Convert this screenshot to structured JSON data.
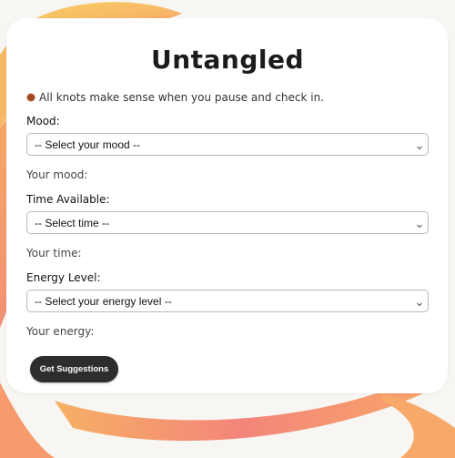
{
  "app": {
    "title": "Untangled",
    "tagline_icon": "yarn-ball-icon",
    "tagline": "All knots make sense when you pause and check in."
  },
  "form": {
    "mood": {
      "label": "Mood:",
      "selected": "-- Select your mood --",
      "result": "Your mood:"
    },
    "time": {
      "label": "Time Available:",
      "selected": "-- Select time --",
      "result": "Your time:"
    },
    "energy": {
      "label": "Energy Level:",
      "selected": "-- Select your energy level --",
      "result": "Your energy:"
    },
    "submit_label": "Get Suggestions"
  },
  "colors": {
    "background_gradient": [
      "#f8c25a",
      "#f5876f",
      "#f7a567"
    ],
    "card": "#ffffff",
    "button": "#2d2d2d"
  }
}
